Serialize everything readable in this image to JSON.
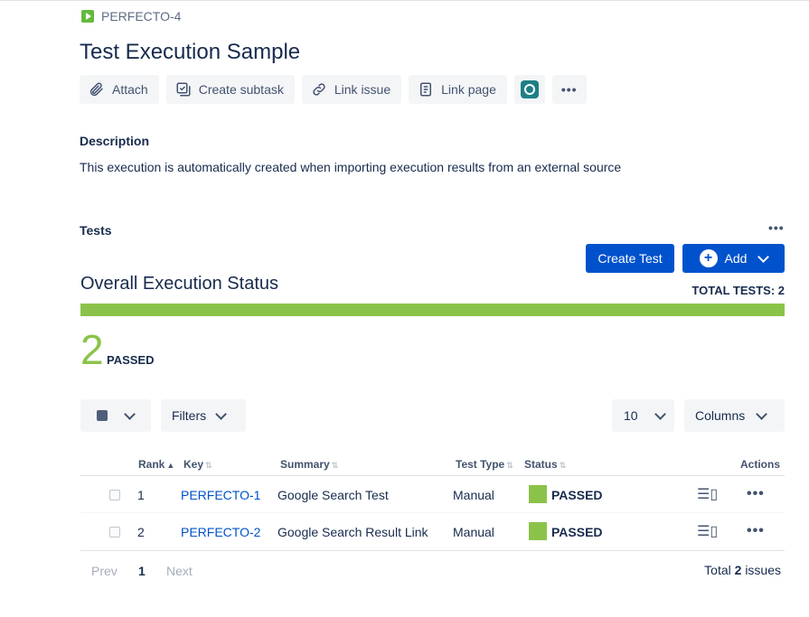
{
  "breadcrumb": {
    "issue_key": "PERFECTO-4"
  },
  "page": {
    "title": "Test Execution Sample"
  },
  "toolbar": {
    "attach": "Attach",
    "create_subtask": "Create subtask",
    "link_issue": "Link issue",
    "link_page": "Link page",
    "more": "•••"
  },
  "description": {
    "label": "Description",
    "text": "This execution is automatically created when importing execution results from an external source"
  },
  "tests": {
    "label": "Tests",
    "more": "•••",
    "create_test": "Create Test",
    "add": "Add"
  },
  "overall": {
    "title": "Overall Execution Status",
    "total_tests": "TOTAL TESTS: 2",
    "passed_fraction": 1.0,
    "passed_color": "#8bc34a",
    "passed_count": "2",
    "passed_label": "PASSED"
  },
  "filters": {
    "filters_label": "Filters",
    "page_size": "10",
    "columns_label": "Columns"
  },
  "table": {
    "headers": {
      "rank": "Rank",
      "key": "Key",
      "summary": "Summary",
      "test_type": "Test Type",
      "status": "Status",
      "actions": "Actions"
    },
    "rows": [
      {
        "rank": "1",
        "key": "PERFECTO-1",
        "summary": "Google Search Test",
        "test_type": "Manual",
        "status": "PASSED"
      },
      {
        "rank": "2",
        "key": "PERFECTO-2",
        "summary": "Google Search Result Link",
        "test_type": "Manual",
        "status": "PASSED"
      }
    ]
  },
  "pagination": {
    "prev": "Prev",
    "current": "1",
    "next": "Next",
    "total_prefix": "Total",
    "total_count": "2",
    "total_suffix": "issues"
  }
}
